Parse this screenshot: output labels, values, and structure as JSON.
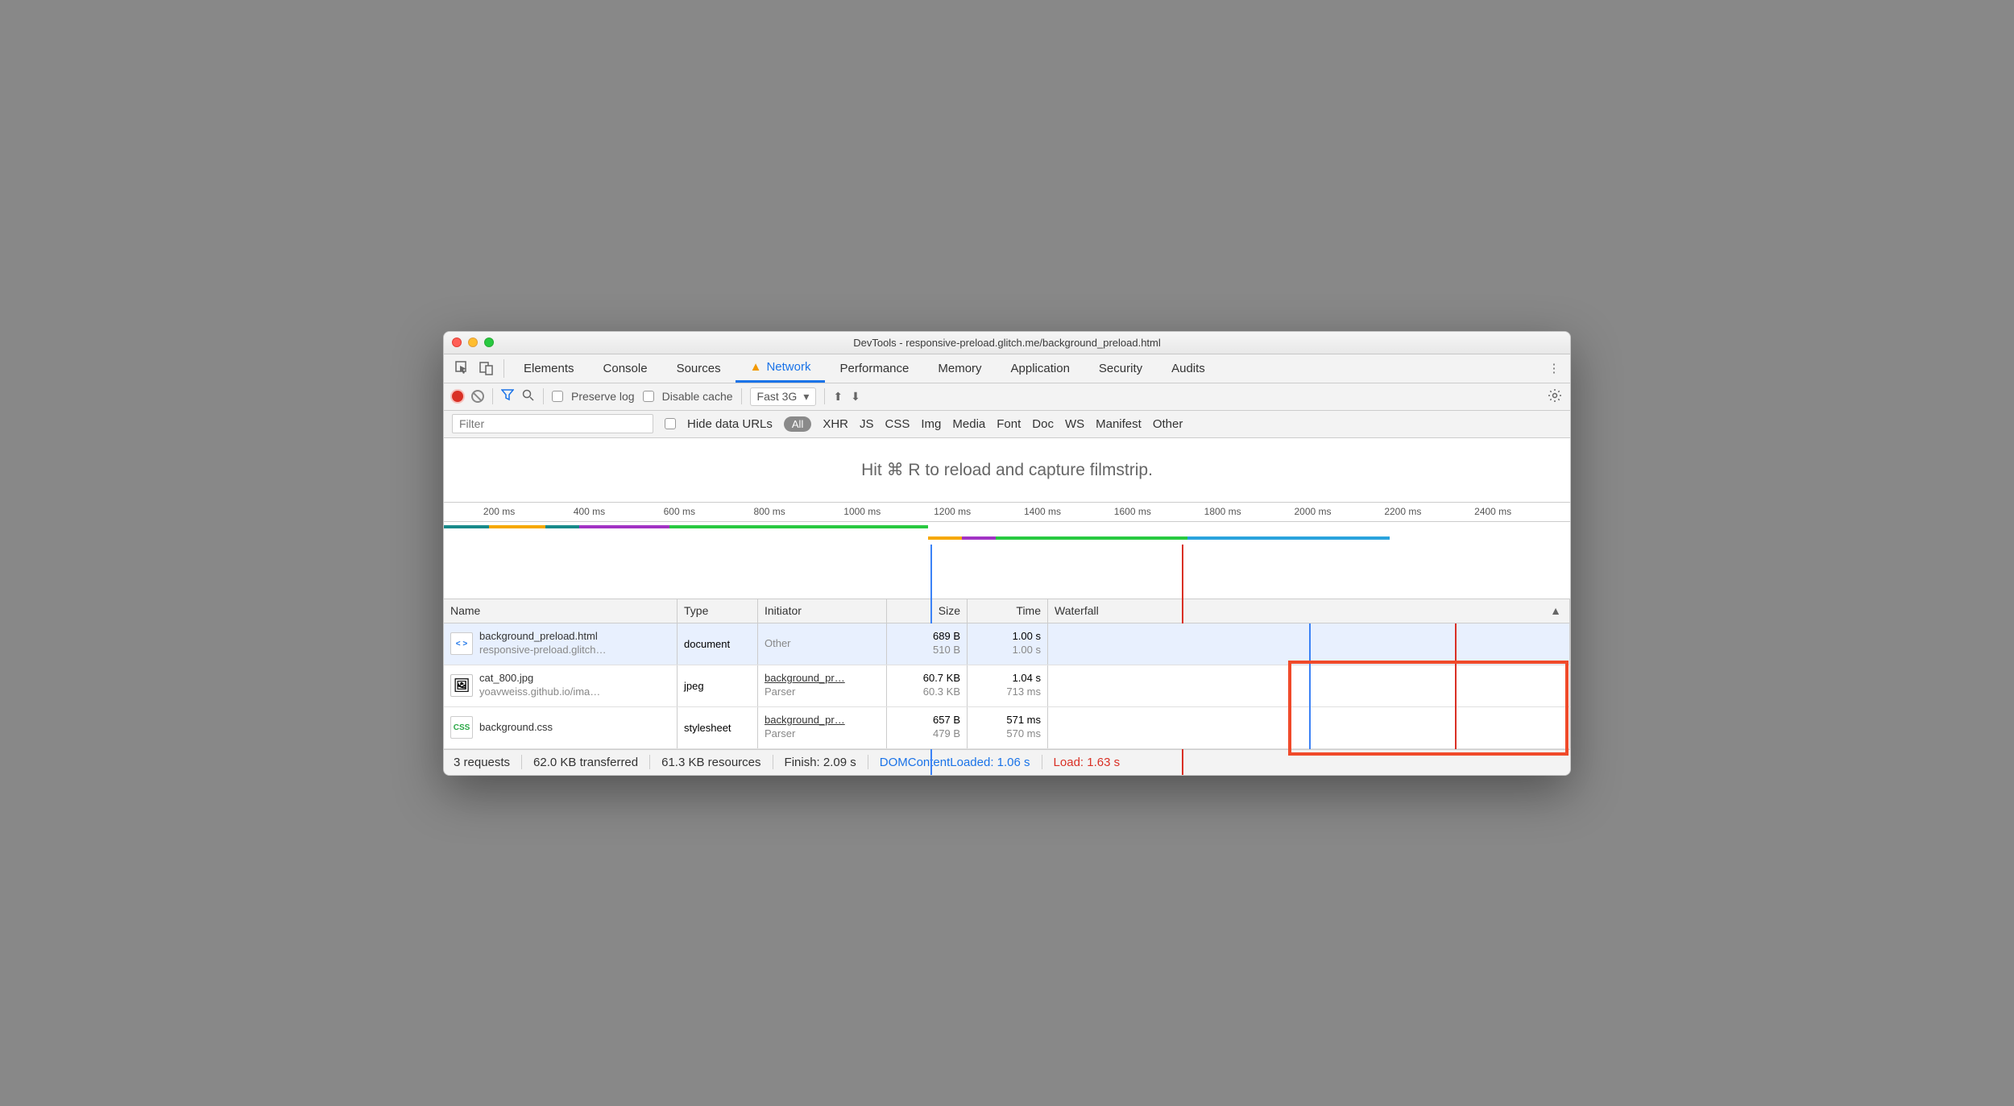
{
  "window": {
    "title": "DevTools - responsive-preload.glitch.me/background_preload.html"
  },
  "panelTabs": {
    "elements": "Elements",
    "console": "Console",
    "sources": "Sources",
    "network": "Network",
    "performance": "Performance",
    "memory": "Memory",
    "application": "Application",
    "security": "Security",
    "audits": "Audits"
  },
  "toolbar": {
    "preserveLog": "Preserve log",
    "disableCache": "Disable cache",
    "throttling": "Fast 3G"
  },
  "filter": {
    "placeholder": "Filter",
    "hideDataUrls": "Hide data URLs",
    "all": "All",
    "types": [
      "XHR",
      "JS",
      "CSS",
      "Img",
      "Media",
      "Font",
      "Doc",
      "WS",
      "Manifest",
      "Other"
    ]
  },
  "filmstrip": {
    "message": "Hit ⌘ R to reload and capture filmstrip."
  },
  "timeline": {
    "ticks": [
      "200 ms",
      "400 ms",
      "600 ms",
      "800 ms",
      "1000 ms",
      "1200 ms",
      "1400 ms",
      "1600 ms",
      "1800 ms",
      "2000 ms",
      "2200 ms",
      "2400 ms"
    ]
  },
  "columns": {
    "name": "Name",
    "type": "Type",
    "initiator": "Initiator",
    "size": "Size",
    "time": "Time",
    "waterfall": "Waterfall"
  },
  "requests": [
    {
      "name": "background_preload.html",
      "sub": "responsive-preload.glitch…",
      "type": "document",
      "initiator": "Other",
      "initiatorSub": "",
      "size": "689 B",
      "sizeSub": "510 B",
      "time": "1.00 s",
      "timeSub": "1.00 s",
      "iconKind": "html",
      "iconLabel": "< >"
    },
    {
      "name": "cat_800.jpg",
      "sub": "yoavweiss.github.io/ima…",
      "type": "jpeg",
      "initiator": "background_pr…",
      "initiatorSub": "Parser",
      "size": "60.7 KB",
      "sizeSub": "60.3 KB",
      "time": "1.04 s",
      "timeSub": "713 ms",
      "iconKind": "img",
      "iconLabel": "🖼"
    },
    {
      "name": "background.css",
      "sub": "",
      "type": "stylesheet",
      "initiator": "background_pr…",
      "initiatorSub": "Parser",
      "size": "657 B",
      "sizeSub": "479 B",
      "time": "571 ms",
      "timeSub": "570 ms",
      "iconKind": "css",
      "iconLabel": "CSS"
    }
  ],
  "status": {
    "requests": "3 requests",
    "transferred": "62.0 KB transferred",
    "resources": "61.3 KB resources",
    "finish": "Finish: 2.09 s",
    "dcl": "DOMContentLoaded: 1.06 s",
    "load": "Load: 1.63 s"
  }
}
